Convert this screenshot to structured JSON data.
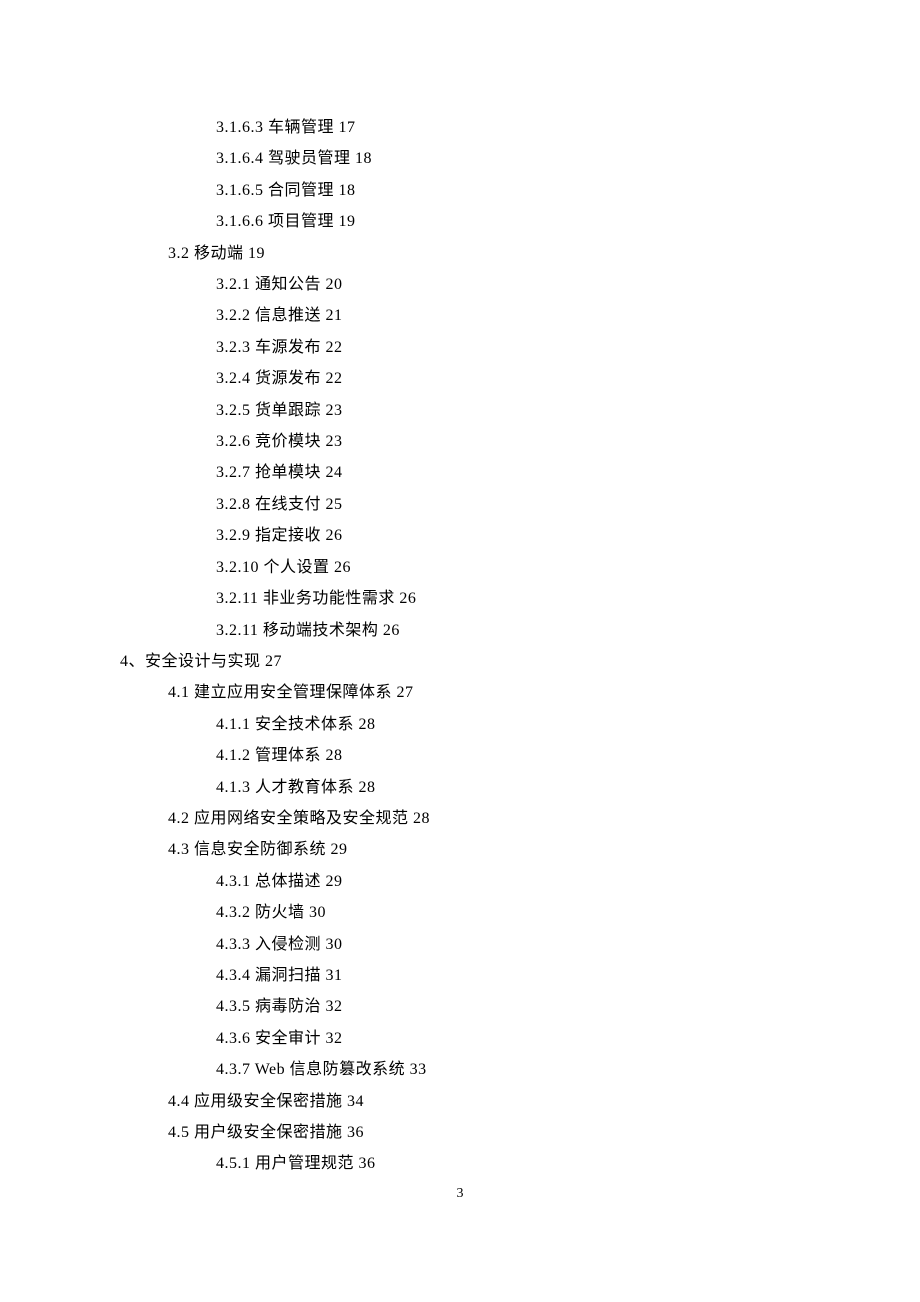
{
  "page_number": "3",
  "toc": [
    {
      "level": 2,
      "num": "3.1.6.3",
      "title": "车辆管理",
      "page": "17"
    },
    {
      "level": 2,
      "num": "3.1.6.4",
      "title": "驾驶员管理",
      "page": "18"
    },
    {
      "level": 2,
      "num": "3.1.6.5",
      "title": "合同管理",
      "page": "18"
    },
    {
      "level": 2,
      "num": "3.1.6.6",
      "title": "项目管理",
      "page": "19"
    },
    {
      "level": 1,
      "num": "3.2",
      "title": "移动端",
      "page": "19"
    },
    {
      "level": 2,
      "num": "3.2.1",
      "title": "通知公告",
      "page": "20"
    },
    {
      "level": 2,
      "num": "3.2.2",
      "title": "信息推送",
      "page": "21"
    },
    {
      "level": 2,
      "num": "3.2.3",
      "title": "车源发布",
      "page": "22"
    },
    {
      "level": 2,
      "num": "3.2.4",
      "title": "货源发布",
      "page": "22"
    },
    {
      "level": 2,
      "num": "3.2.5",
      "title": "货单跟踪",
      "page": "23"
    },
    {
      "level": 2,
      "num": "3.2.6",
      "title": "竞价模块",
      "page": "23"
    },
    {
      "level": 2,
      "num": "3.2.7",
      "title": "抢单模块",
      "page": "24"
    },
    {
      "level": 2,
      "num": "3.2.8",
      "title": "在线支付",
      "page": "25"
    },
    {
      "level": 2,
      "num": "3.2.9",
      "title": "指定接收",
      "page": "26"
    },
    {
      "level": 2,
      "num": "3.2.10",
      "title": "个人设置",
      "page": "26"
    },
    {
      "level": 2,
      "num": "3.2.11",
      "title": "非业务功能性需求",
      "page": "26"
    },
    {
      "level": 2,
      "num": "3.2.11",
      "title": "移动端技术架构",
      "page": "26"
    },
    {
      "level": 0,
      "num": "4、",
      "title": "安全设计与实现",
      "page": "27"
    },
    {
      "level": 1,
      "num": "4.1",
      "title": "建立应用安全管理保障体系",
      "page": "27"
    },
    {
      "level": 2,
      "num": "4.1.1",
      "title": "安全技术体系",
      "page": "28"
    },
    {
      "level": 2,
      "num": "4.1.2",
      "title": "管理体系",
      "page": "28"
    },
    {
      "level": 2,
      "num": "4.1.3",
      "title": "人才教育体系",
      "page": "28"
    },
    {
      "level": 1,
      "num": "4.2",
      "title": "应用网络安全策略及安全规范",
      "page": "28"
    },
    {
      "level": 1,
      "num": "4.3",
      "title": "信息安全防御系统",
      "page": "29"
    },
    {
      "level": 2,
      "num": "4.3.1",
      "title": "总体描述",
      "page": "29"
    },
    {
      "level": 2,
      "num": "4.3.2",
      "title": "防火墙",
      "page": "30"
    },
    {
      "level": 2,
      "num": "4.3.3",
      "title": "入侵检测",
      "page": "30"
    },
    {
      "level": 2,
      "num": "4.3.4",
      "title": "漏洞扫描",
      "page": "31"
    },
    {
      "level": 2,
      "num": "4.3.5",
      "title": "病毒防治",
      "page": "32"
    },
    {
      "level": 2,
      "num": "4.3.6",
      "title": "安全审计",
      "page": "32"
    },
    {
      "level": 2,
      "num": "4.3.7",
      "title": "Web 信息防篡改系统",
      "page": "33"
    },
    {
      "level": 1,
      "num": "4.4",
      "title": "应用级安全保密措施",
      "page": "34"
    },
    {
      "level": 1,
      "num": "4.5",
      "title": "用户级安全保密措施",
      "page": "36"
    },
    {
      "level": 2,
      "num": "4.5.1",
      "title": "用户管理规范",
      "page": "36"
    }
  ]
}
